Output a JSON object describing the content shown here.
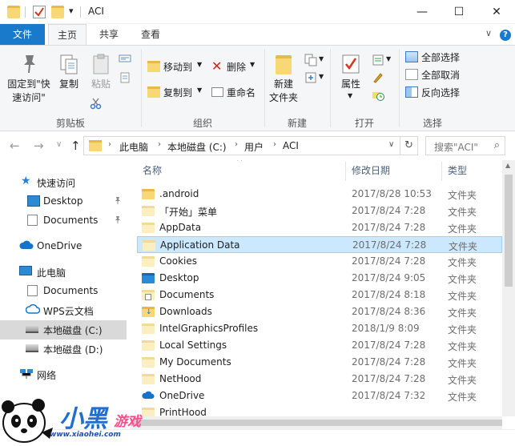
{
  "window": {
    "title": "ACI",
    "minimize": "—",
    "maximize": "☐",
    "close": "✕",
    "quick_access_dropdown": "▾"
  },
  "tabs": {
    "file": "文件",
    "home": "主页",
    "share": "共享",
    "view": "查看",
    "collapse": "∨",
    "help": "?"
  },
  "ribbon": {
    "clipboard": {
      "group": "剪贴板",
      "pin": "固定到\"快\n速访问\"",
      "copy": "复制",
      "paste": "粘贴"
    },
    "organize": {
      "group": "组织",
      "move_to": "移动到",
      "copy_to": "复制到",
      "delete": "删除",
      "rename": "重命名"
    },
    "new": {
      "group": "新建",
      "new_folder": "新建\n文件夹"
    },
    "open": {
      "group": "打开",
      "properties": "属性"
    },
    "select": {
      "group": "选择",
      "select_all": "全部选择",
      "select_none": "全部取消",
      "invert": "反向选择"
    }
  },
  "address": {
    "segments": [
      "此电脑",
      "本地磁盘 (C:)",
      "用户",
      "ACI"
    ],
    "search_placeholder": "搜索\"ACI\"",
    "back": "←",
    "forward": "→",
    "recent": "∨",
    "up": "↑",
    "refresh": "↻",
    "search_icon": "⌕"
  },
  "navpane": {
    "quick_access": "快速访问",
    "desktop": "Desktop",
    "documents": "Documents",
    "onedrive": "OneDrive",
    "this_pc": "此电脑",
    "pc_documents": "Documents",
    "wps": "WPS云文档",
    "drive_c": "本地磁盘 (C:)",
    "drive_d": "本地磁盘 (D:)",
    "network": "网络",
    "pin_icon": "📌"
  },
  "columns": {
    "name": "名称",
    "date": "修改日期",
    "type": "类型"
  },
  "files": [
    {
      "name": ".android",
      "date": "2017/8/28 10:53",
      "type": "文件夹",
      "icon": "folder-yellow"
    },
    {
      "name": "「开始」菜单",
      "date": "2017/8/24 7:28",
      "type": "文件夹",
      "icon": "folder-pale"
    },
    {
      "name": "AppData",
      "date": "2017/8/24 7:28",
      "type": "文件夹",
      "icon": "folder-pale"
    },
    {
      "name": "Application Data",
      "date": "2017/8/24 7:28",
      "type": "文件夹",
      "icon": "folder-pale"
    },
    {
      "name": "Cookies",
      "date": "2017/8/24 7:28",
      "type": "文件夹",
      "icon": "folder-pale"
    },
    {
      "name": "Desktop",
      "date": "2017/8/24 9:05",
      "type": "文件夹",
      "icon": "folder-blue"
    },
    {
      "name": "Documents",
      "date": "2017/8/24 8:18",
      "type": "文件夹",
      "icon": "documents"
    },
    {
      "name": "Downloads",
      "date": "2017/8/24 8:36",
      "type": "文件夹",
      "icon": "downloads"
    },
    {
      "name": "IntelGraphicsProfiles",
      "date": "2018/1/9 8:09",
      "type": "文件夹",
      "icon": "folder-pale"
    },
    {
      "name": "Local Settings",
      "date": "2017/8/24 7:28",
      "type": "文件夹",
      "icon": "folder-pale"
    },
    {
      "name": "My Documents",
      "date": "2017/8/24 7:28",
      "type": "文件夹",
      "icon": "folder-pale"
    },
    {
      "name": "NetHood",
      "date": "2017/8/24 7:28",
      "type": "文件夹",
      "icon": "folder-pale"
    },
    {
      "name": "OneDrive",
      "date": "2017/8/24 7:32",
      "type": "文件夹",
      "icon": "onedrive"
    },
    {
      "name": "PrintHood",
      "date": "",
      "type": "",
      "icon": "folder-pale"
    }
  ],
  "watermark": {
    "brand_big": "小黑",
    "brand_small": "游戏",
    "url": "www.xiaohei.com"
  },
  "colors": {
    "accent": "#1979ca",
    "selection_bg": "#cce8ff",
    "selection_border": "#99d1ff",
    "folder": "#f8d775"
  }
}
